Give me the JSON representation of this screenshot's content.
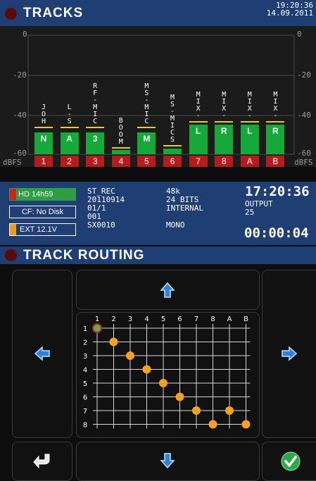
{
  "header": {
    "title": "TRACKS",
    "time": "19:20:36",
    "date": "14.09.2011"
  },
  "meters": {
    "scale_labels": [
      "0",
      "-20",
      "-40",
      "-60"
    ],
    "unit": "dBFS",
    "channels": [
      {
        "track": "1",
        "name": "N",
        "label_chars": [
          "J",
          "O",
          "H"
        ],
        "level_db": -49,
        "peak_db": -47
      },
      {
        "track": "2",
        "name": "A",
        "label_chars": [
          "L",
          "-",
          "S"
        ],
        "level_db": -49,
        "peak_db": -47
      },
      {
        "track": "3",
        "name": "3",
        "label_chars": [
          "R",
          "F",
          "-",
          "M",
          "I",
          "C"
        ],
        "level_db": -49,
        "peak_db": -47
      },
      {
        "track": "4",
        "name": "",
        "label_chars": [
          "B",
          "O",
          "O",
          "M"
        ],
        "level_db": -58,
        "peak_db": -57
      },
      {
        "track": "5",
        "name": "M",
        "label_chars": [
          "M",
          "S",
          "-",
          "M",
          "I",
          "C"
        ],
        "level_db": -49,
        "peak_db": -47
      },
      {
        "track": "6",
        "name": "",
        "label_chars": [
          "M",
          "S",
          "-",
          "M",
          "I",
          "C",
          "S"
        ],
        "level_db": -57,
        "peak_db": -56
      },
      {
        "track": "7",
        "name": "L",
        "label_chars": [
          "M",
          "I",
          "X",
          "-"
        ],
        "level_db": -45,
        "peak_db": -44
      },
      {
        "track": "8",
        "name": "R",
        "label_chars": [
          "M",
          "I",
          "X",
          "-"
        ],
        "level_db": -45,
        "peak_db": -44
      },
      {
        "track": "A",
        "name": "L",
        "label_chars": [
          "M",
          "I",
          "X",
          "-"
        ],
        "level_db": -45,
        "peak_db": -44
      },
      {
        "track": "B",
        "name": "R",
        "label_chars": [
          "M",
          "I",
          "X",
          "-"
        ],
        "level_db": -45,
        "peak_db": -44
      }
    ]
  },
  "status": {
    "hd": "HD 14h59",
    "cf": "CF: No Disk",
    "ext": "EXT 12.1V",
    "col1": [
      "ST_REC",
      "20110914",
      "01/1",
      "001",
      "SX0010"
    ],
    "col2": [
      "48k",
      "24 BITS",
      "INTERNAL",
      "",
      "MONO"
    ],
    "time_big": "17:20:36",
    "output": "OUTPUT",
    "output_val": "25",
    "counter": "00:00:04"
  },
  "routing": {
    "title": "TRACK ROUTING",
    "col_labels": [
      "1",
      "2",
      "3",
      "4",
      "5",
      "6",
      "7",
      "8",
      "A",
      "B"
    ],
    "row_labels": [
      "1",
      "2",
      "3",
      "4",
      "5",
      "6",
      "7",
      "8"
    ],
    "connections": [
      [
        1,
        1
      ],
      [
        2,
        2
      ],
      [
        3,
        3
      ],
      [
        4,
        4
      ],
      [
        5,
        5
      ],
      [
        6,
        6
      ],
      [
        7,
        7
      ],
      [
        8,
        8
      ],
      [
        9,
        7
      ],
      [
        10,
        8
      ]
    ],
    "selected": [
      1,
      1
    ]
  },
  "colors": {
    "accent_blue": "#1f3e74",
    "meter_green": "#15a93a",
    "peak_yellow": "#e6cf23",
    "track_red": "#b61c1c",
    "dot_orange": "#f7a21b",
    "confirm_green": "#2fa84a"
  }
}
